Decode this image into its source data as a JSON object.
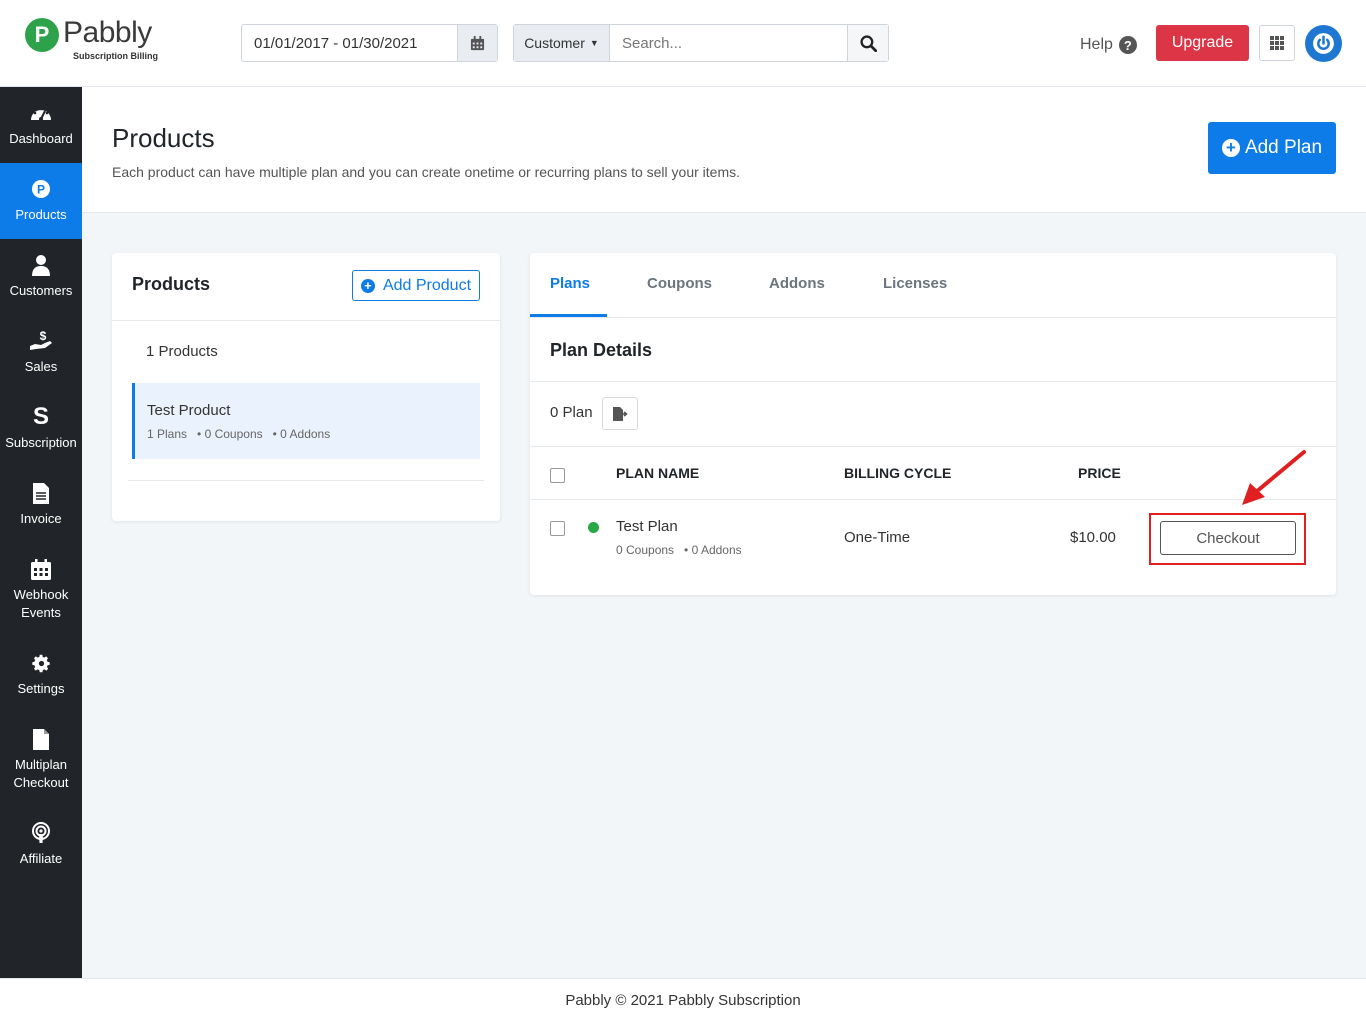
{
  "brand": {
    "name": "Pabbly",
    "sub": "Subscription Billing",
    "mark": "P"
  },
  "header": {
    "date_range": "01/01/2017 - 01/30/2021",
    "search_scope": "Customer",
    "search_placeholder": "Search...",
    "help_label": "Help",
    "upgrade_label": "Upgrade"
  },
  "sidebar": {
    "items": [
      {
        "label": "Dashboard",
        "icon": "dashboard-icon"
      },
      {
        "label": "Products",
        "icon": "products-icon",
        "active": true
      },
      {
        "label": "Customers",
        "icon": "customers-icon"
      },
      {
        "label": "Sales",
        "icon": "sales-icon"
      },
      {
        "label": "Subscription",
        "icon": "subscription-icon"
      },
      {
        "label": "Invoice",
        "icon": "invoice-icon"
      },
      {
        "label": "Webhook Events",
        "icon": "webhook-icon"
      },
      {
        "label": "Settings",
        "icon": "gear-icon"
      },
      {
        "label": "Multiplan Checkout",
        "icon": "file-icon"
      },
      {
        "label": "Affiliate",
        "icon": "affiliate-icon"
      }
    ]
  },
  "page": {
    "title": "Products",
    "description": "Each product can have multiple plan and you can create onetime or recurring plans to sell your items.",
    "add_plan_label": "Add Plan"
  },
  "products_panel": {
    "title": "Products",
    "add_label": "Add Product",
    "count_label": "1 Products",
    "items": [
      {
        "name": "Test Product",
        "plans": "1 Plans",
        "coupons": "0 Coupons",
        "addons": "0 Addons"
      }
    ]
  },
  "plans_panel": {
    "tabs": [
      "Plans",
      "Coupons",
      "Addons",
      "Licenses"
    ],
    "section_title": "Plan Details",
    "plan_count": "0 Plan",
    "columns": [
      "PLAN NAME",
      "BILLING CYCLE",
      "PRICE"
    ],
    "rows": [
      {
        "name": "Test Plan",
        "coupons": "0 Coupons",
        "addons": "0 Addons",
        "cycle": "One-Time",
        "price": "$10.00",
        "action": "Checkout",
        "status_color": "#28a745"
      }
    ]
  },
  "footer": {
    "text": "Pabbly © 2021 Pabbly Subscription"
  },
  "colors": {
    "primary": "#0d7be8",
    "danger": "#dc3545",
    "sidebar": "#212529",
    "annotation": "#e02020"
  }
}
